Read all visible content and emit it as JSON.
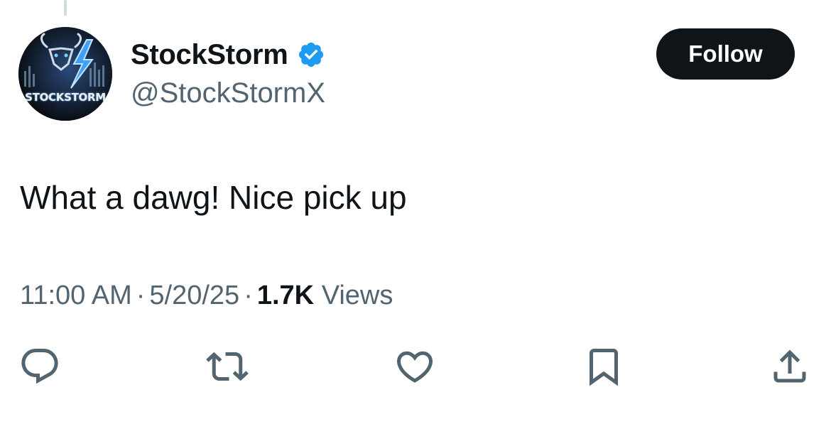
{
  "author": {
    "display_name": "StockStorm",
    "handle": "@StockStormX",
    "verified": true,
    "avatar_icon": "bull-lightning-logo",
    "avatar_wordmark": "STOCKSTORM"
  },
  "follow_button": {
    "label": "Follow"
  },
  "tweet": {
    "text": "What a dawg! Nice pick up",
    "time": "11:00 AM",
    "date": "5/20/25",
    "separator": "·",
    "views_count": "1.7K",
    "views_label": "Views"
  },
  "actions": [
    {
      "name": "reply",
      "icon": "reply-icon"
    },
    {
      "name": "retweet",
      "icon": "retweet-icon"
    },
    {
      "name": "like",
      "icon": "heart-icon"
    },
    {
      "name": "bookmark",
      "icon": "bookmark-icon"
    },
    {
      "name": "share",
      "icon": "share-icon"
    }
  ],
  "colors": {
    "text_primary": "#0f1419",
    "text_secondary": "#536471",
    "verified_blue": "#1d9bf0",
    "follow_bg": "#0f1419",
    "follow_text": "#ffffff",
    "thread_line": "#cfd9de"
  }
}
